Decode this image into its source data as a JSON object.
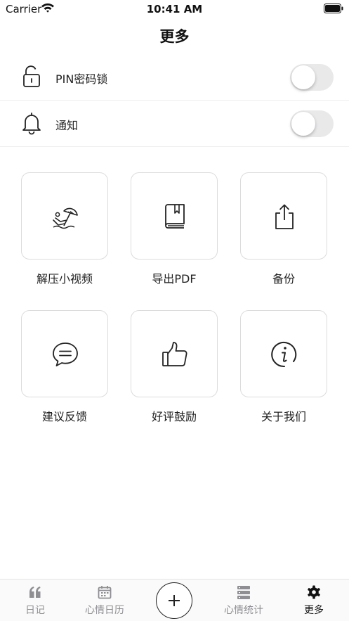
{
  "status_bar": {
    "carrier": "Carrier",
    "time": "10:41 AM"
  },
  "header": {
    "title": "更多"
  },
  "settings": [
    {
      "label": "PIN密码锁",
      "icon": "unlock-icon",
      "enabled": false
    },
    {
      "label": "通知",
      "icon": "bell-icon",
      "enabled": false
    }
  ],
  "tiles": [
    {
      "label": "解压小视频",
      "icon": "beach-umbrella-icon"
    },
    {
      "label": "导出PDF",
      "icon": "book-icon"
    },
    {
      "label": "备份",
      "icon": "share-upload-icon"
    },
    {
      "label": "建议反馈",
      "icon": "chat-bubble-icon"
    },
    {
      "label": "好评鼓励",
      "icon": "thumbs-up-icon"
    },
    {
      "label": "关于我们",
      "icon": "info-icon"
    }
  ],
  "tab_bar": {
    "items": [
      {
        "label": "日记",
        "icon": "quote-icon"
      },
      {
        "label": "心情日历",
        "icon": "calendar-icon"
      },
      {
        "label": "",
        "icon": "plus-icon"
      },
      {
        "label": "心情统计",
        "icon": "server-list-icon"
      },
      {
        "label": "更多",
        "icon": "gear-icon"
      }
    ],
    "active": "更多"
  }
}
